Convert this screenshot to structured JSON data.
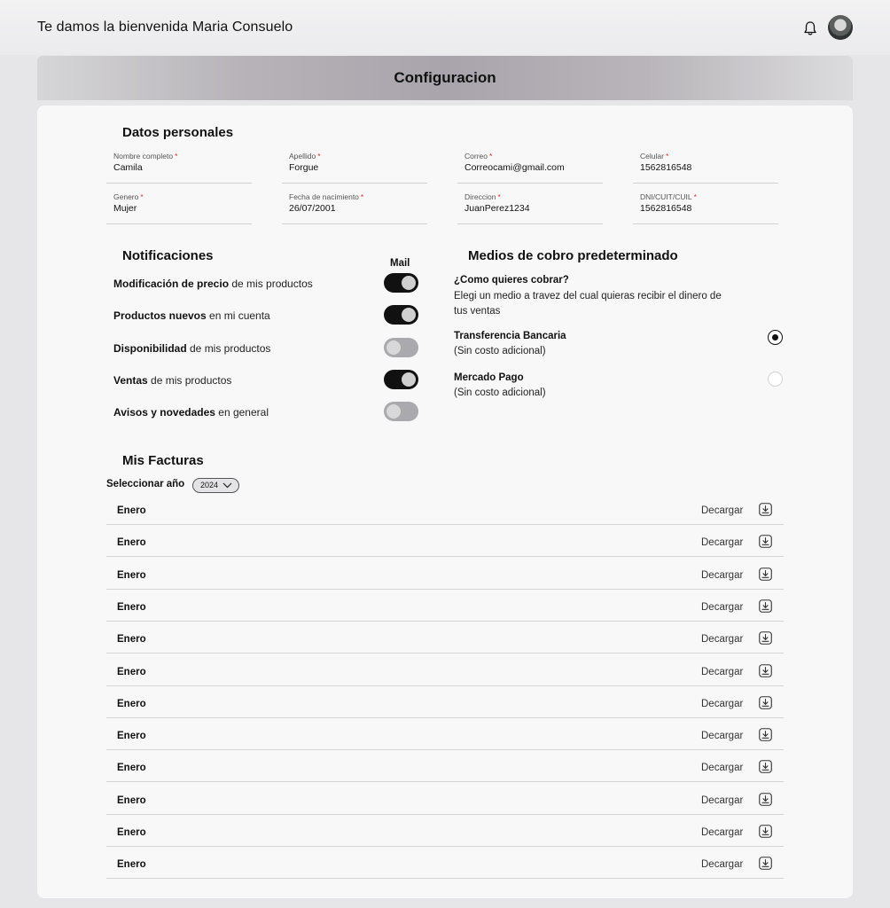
{
  "header": {
    "welcome": "Te damos la bienvenida Maria Consuelo",
    "bell_icon": "bell-icon",
    "avatar": "user-avatar"
  },
  "banner": {
    "title": "Configuracion"
  },
  "personal": {
    "title": "Datos personales",
    "fields": [
      {
        "label": "Nombre completo",
        "value": "Camila"
      },
      {
        "label": "Apellido",
        "value": "Forgue"
      },
      {
        "label": "Correo",
        "value": "Correocami@gmail.com"
      },
      {
        "label": "Celular",
        "value": "1562816548"
      },
      {
        "label": "Genero",
        "value": "Mujer"
      },
      {
        "label": "Fecha de nacimiento",
        "value": "26/07/2001"
      },
      {
        "label": "Direccion",
        "value": "JuanPerez1234"
      },
      {
        "label": "DNI/CUIT/CUIL",
        "value": "1562816548"
      }
    ],
    "required_mark": "*"
  },
  "notifications": {
    "title": "Notificaciones",
    "column_label": "Mail",
    "items": [
      {
        "bold": "Modificación de precio",
        "rest": " de mis productos",
        "on": true
      },
      {
        "bold": "Productos nuevos",
        "rest": " en mi cuenta",
        "on": true
      },
      {
        "bold": "Disponibilidad",
        "rest": " de mis productos",
        "on": false
      },
      {
        "bold": "Ventas",
        "rest": " de mis productos",
        "on": true
      },
      {
        "bold": "Avisos y novedades",
        "rest": " en general",
        "on": false
      }
    ]
  },
  "payment": {
    "title": "Medios de cobro predeterminado",
    "question": "¿Como quieres cobrar?",
    "description": "Elegi un medio a travez del cual quieras recibir el dinero de tus ventas",
    "options": [
      {
        "name": "Transferencia Bancaria",
        "sub": "(Sin costo adicional)",
        "selected": true
      },
      {
        "name": "Mercado Pago",
        "sub": "(Sin costo adicional)",
        "selected": false
      }
    ]
  },
  "invoices": {
    "title": "Mis Facturas",
    "year_label": "Seleccionar año",
    "year_value": "2024",
    "download_label": "Decargar",
    "rows": [
      "Enero",
      "Enero",
      "Enero",
      "Enero",
      "Enero",
      "Enero",
      "Enero",
      "Enero",
      "Enero",
      "Enero",
      "Enero",
      "Enero"
    ]
  }
}
